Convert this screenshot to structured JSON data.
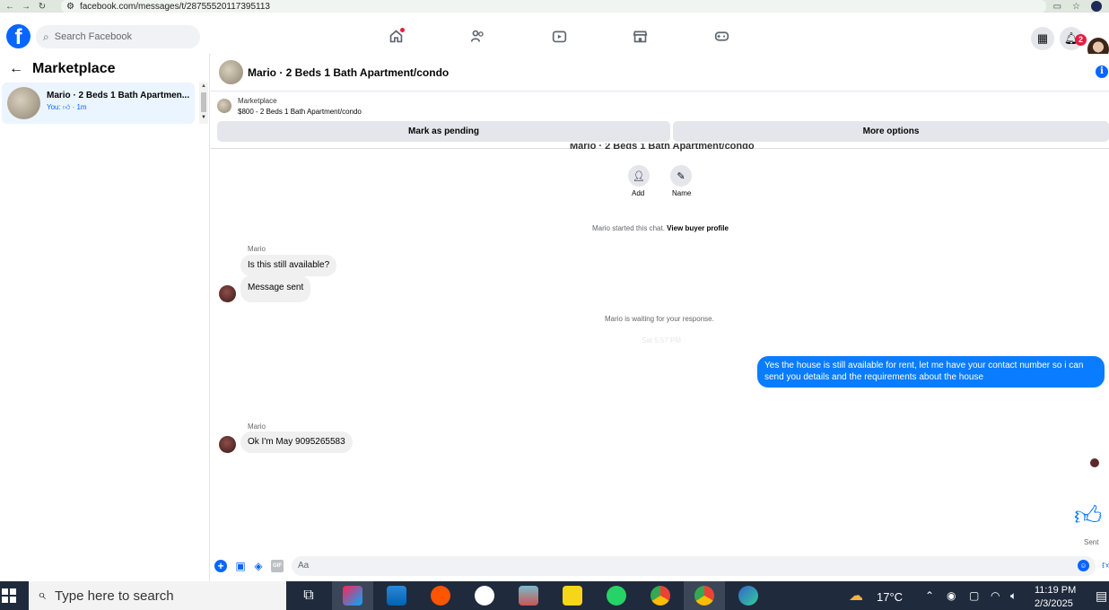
{
  "browser": {
    "url": "facebook.com/messages/t/28755520117395113"
  },
  "topnav": {
    "logo": "f",
    "search_placeholder": "Search Facebook",
    "notifications_count": "2"
  },
  "sidebar": {
    "title": "Marketplace",
    "conversations": [
      {
        "title": "Mario · 2 Beds 1 Bath Apartmen...",
        "you": "You:",
        "time": "· 1m"
      }
    ]
  },
  "chat": {
    "title": "Mario · 2 Beds 1 Bath Apartment/condo",
    "listing_label": "Marketplace",
    "listing_price": "$800 - 2 Beds 1 Bath Apartment/condo",
    "mark_pending": "Mark as pending",
    "more_options": "More options",
    "cut_title": "Mario · 2 Beds 1 Bath Apartment/condo",
    "add_label": "Add",
    "name_label": "Name",
    "started_text": "Mario started this chat.",
    "view_profile": "View buyer profile",
    "waiting_text": "Mario is waiting for your response.",
    "timestamp": "Sat 5:57 PM",
    "messages": [
      {
        "sender": "Mario",
        "text": "Is this still available?"
      },
      {
        "text": "Message sent"
      },
      {
        "text": "Yes the house is still available for rent, let me have your contact number  so i can send you details and the requirements about the house"
      },
      {
        "sender": "Mario",
        "text": "Ok I'm May 9095265583"
      }
    ],
    "sent_label": "Sent",
    "composer_placeholder": "Aa"
  },
  "taskbar": {
    "search_placeholder": "Type here to search",
    "temperature": "17°C",
    "time": "11:19 PM",
    "date": "2/3/2025"
  },
  "colors": {
    "brand": "#0866ff",
    "outgoing_bubble": "#0a7cff",
    "incoming_bubble": "#f0f0f0",
    "taskbar": "#1f2a3d"
  },
  "icons": [
    "home-icon",
    "friends-icon",
    "video-icon",
    "marketplace-icon",
    "gaming-icon",
    "menu-grid-icon",
    "bell-icon",
    "info-icon",
    "add-person-icon",
    "pencil-icon",
    "like-icon"
  ]
}
